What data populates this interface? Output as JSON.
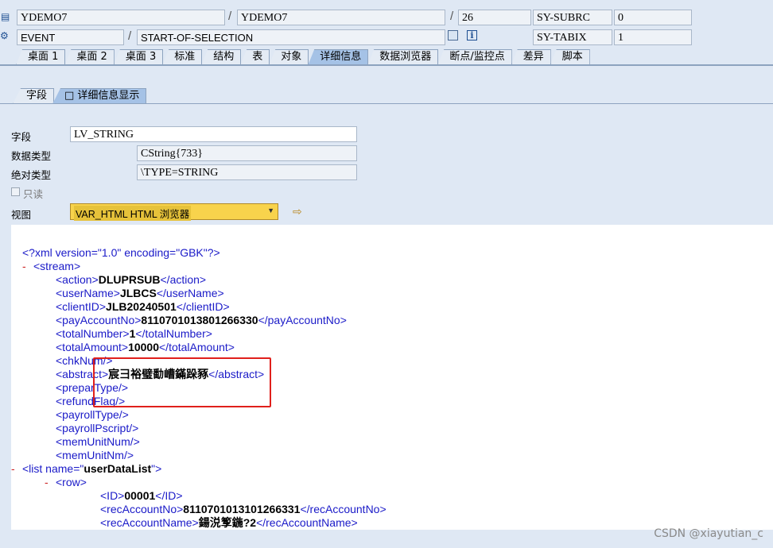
{
  "header": {
    "row1": {
      "icon": "program-icon",
      "program": "YDEMO7",
      "include": "YDEMO7",
      "line": "26",
      "sysvar": "SY-SUBRC",
      "sysvar_value": "0"
    },
    "row2": {
      "icon": "event-icon",
      "type": "EVENT",
      "event": "START-OF-SELECTION",
      "sysvar": "SY-TABIX",
      "sysvar_value": "1"
    }
  },
  "tabs": [
    "桌面 1",
    "桌面 2",
    "桌面 3",
    "标准",
    "结构",
    "表",
    "对象",
    "详细信息",
    "数据浏览器",
    "断点/监控点",
    "差异",
    "脚本"
  ],
  "active_tab": "详细信息",
  "subtabs": {
    "field": "字段",
    "detail": "□ 详细信息显示"
  },
  "form": {
    "field_label": "字段",
    "field_value": "LV_STRING",
    "datatype_label": "数据类型",
    "datatype_value": "CString{733}",
    "abstype_label": "绝对类型",
    "abstype_value": "\\TYPE=STRING",
    "readonly_label": "只读",
    "view_label": "视图",
    "view_value": "VAR_HTML HTML 浏览器"
  },
  "xml_lines": [
    {
      "indent": 1,
      "prefix": "",
      "open": "<?xml version=\"1.0\" encoding=\"GBK\"?>",
      "value": "",
      "close": ""
    },
    {
      "indent": 0,
      "prefix": "-",
      "open": "<stream>",
      "value": "",
      "close": ""
    },
    {
      "indent": 2,
      "prefix": "",
      "open": "<action>",
      "value": "DLUPRSUB",
      "close": "</action>"
    },
    {
      "indent": 2,
      "prefix": "",
      "open": "<userName>",
      "value": "JLBCS",
      "close": "</userName>"
    },
    {
      "indent": 2,
      "prefix": "",
      "open": "<clientID>",
      "value": "JLB20240501",
      "close": "</clientID>"
    },
    {
      "indent": 2,
      "prefix": "",
      "open": "<payAccountNo>",
      "value": "8110701013801266330",
      "close": "</payAccountNo>"
    },
    {
      "indent": 2,
      "prefix": "",
      "open": "<totalNumber>",
      "value": "1",
      "close": "</totalNumber>"
    },
    {
      "indent": 2,
      "prefix": "",
      "open": "<totalAmount>",
      "value": "10000",
      "close": "</totalAmount>"
    },
    {
      "indent": 2,
      "prefix": "",
      "open": "<chkNum/>",
      "value": "",
      "close": ""
    },
    {
      "indent": 2,
      "prefix": "",
      "open": "<abstract>",
      "value": "宸彐裕璧勫嶆鏋跺豩",
      "close": "</abstract>"
    },
    {
      "indent": 2,
      "prefix": "",
      "open": "<preparType/>",
      "value": "",
      "close": ""
    },
    {
      "indent": 2,
      "prefix": "",
      "open": "<refundFlag/>",
      "value": "",
      "close": ""
    },
    {
      "indent": 2,
      "prefix": "",
      "open": "<payrollType/>",
      "value": "",
      "close": ""
    },
    {
      "indent": 2,
      "prefix": "",
      "open": "<payrollPscript/>",
      "value": "",
      "close": ""
    },
    {
      "indent": 2,
      "prefix": "",
      "open": "<memUnitNum/>",
      "value": "",
      "close": ""
    },
    {
      "indent": 2,
      "prefix": "",
      "open": "<memUnitNm/>",
      "value": "",
      "close": ""
    },
    {
      "indent": 1,
      "prefix": "-",
      "open": "<list name=\"",
      "value": "userDataList",
      "close": "\">"
    },
    {
      "indent": 2,
      "prefix": "-",
      "open": "<row>",
      "value": "",
      "close": ""
    },
    {
      "indent": 4,
      "prefix": "",
      "open": "<ID>",
      "value": "00001",
      "close": "</ID>"
    },
    {
      "indent": 4,
      "prefix": "",
      "open": "<recAccountNo>",
      "value": "8110701013101266331",
      "close": "</recAccountNo>"
    },
    {
      "indent": 4,
      "prefix": "",
      "open": "<recAccountName>",
      "value": "鍚涚箰鍦?2",
      "close": "</recAccountName>"
    }
  ],
  "watermark": "CSDN @xiayutian_c",
  "colors": {
    "accent": "#a5c2e6",
    "tag": "#1a1ac8",
    "highlight_box": "#e0201c",
    "view_select": "#f8d34c"
  }
}
